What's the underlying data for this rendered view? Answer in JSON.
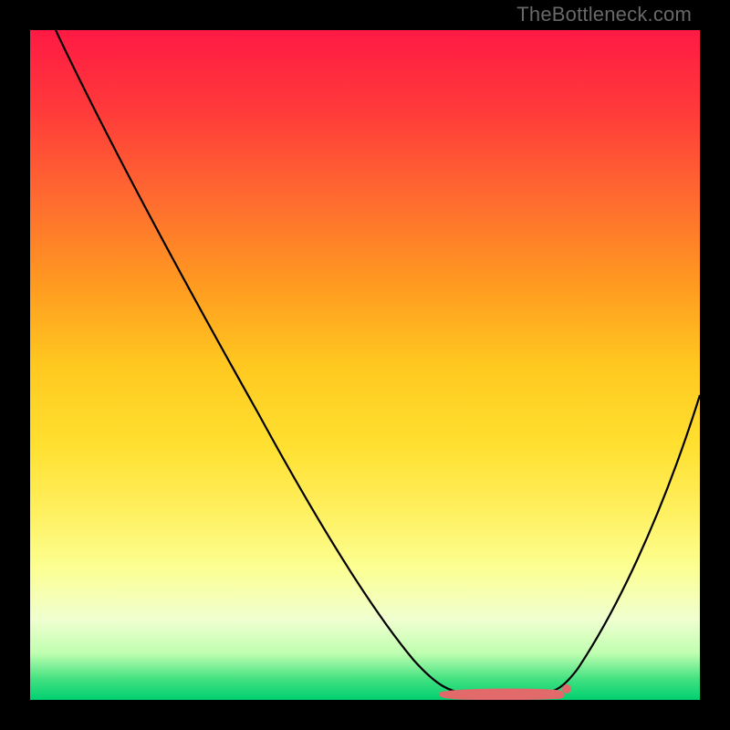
{
  "watermark": {
    "text": "TheBottleneck.com"
  },
  "chart_data": {
    "type": "line",
    "title": "",
    "xlabel": "",
    "ylabel": "",
    "xlim": [
      0,
      100
    ],
    "ylim": [
      0,
      100
    ],
    "grid": false,
    "legend": false,
    "background": "rainbow-vertical-gradient",
    "curve": {
      "description": "bottleneck-style curve; steep descent from top-left, minimum plateau near x=64..78, rises toward right edge",
      "points": [
        {
          "x": 4,
          "y": 100
        },
        {
          "x": 12,
          "y": 85
        },
        {
          "x": 20,
          "y": 70
        },
        {
          "x": 28,
          "y": 56
        },
        {
          "x": 36,
          "y": 42
        },
        {
          "x": 44,
          "y": 28
        },
        {
          "x": 52,
          "y": 14
        },
        {
          "x": 58,
          "y": 5
        },
        {
          "x": 62,
          "y": 1.2
        },
        {
          "x": 66,
          "y": 0.5
        },
        {
          "x": 70,
          "y": 0.5
        },
        {
          "x": 74,
          "y": 0.5
        },
        {
          "x": 78,
          "y": 1.0
        },
        {
          "x": 80,
          "y": 2.5
        },
        {
          "x": 84,
          "y": 9
        },
        {
          "x": 88,
          "y": 18
        },
        {
          "x": 92,
          "y": 28
        },
        {
          "x": 96,
          "y": 38
        },
        {
          "x": 100,
          "y": 48
        }
      ]
    },
    "marker_band": {
      "description": "short reddish band at the minimum",
      "color": "#e26a6a",
      "x_start": 61,
      "x_end": 79,
      "y": 0.7
    }
  }
}
